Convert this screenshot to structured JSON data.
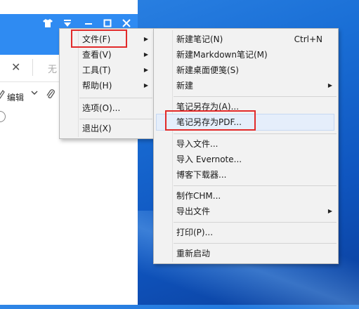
{
  "app": {
    "tab_new_text": "无",
    "toolbar_edit_label": "编辑"
  },
  "main_menu": {
    "items": [
      {
        "label": "文件(F)",
        "has_submenu": true
      },
      {
        "label": "查看(V)",
        "has_submenu": true
      },
      {
        "label": "工具(T)",
        "has_submenu": true
      },
      {
        "label": "帮助(H)",
        "has_submenu": true
      },
      {
        "label": "选项(O)...",
        "has_submenu": false
      },
      {
        "label": "退出(X)",
        "has_submenu": false
      }
    ]
  },
  "file_submenu": {
    "items": [
      {
        "label": "新建笔记(N)",
        "shortcut": "Ctrl+N"
      },
      {
        "label": "新建Markdown笔记(M)"
      },
      {
        "label": "新建桌面便笺(S)"
      },
      {
        "label": "新建",
        "has_submenu": true
      },
      {
        "label": "笔记另存为(A)..."
      },
      {
        "label": "笔记另存为PDF..."
      },
      {
        "label": "导入文件..."
      },
      {
        "label": "导入 Evernote..."
      },
      {
        "label": "博客下载器..."
      },
      {
        "label": "制作CHM..."
      },
      {
        "label": "导出文件",
        "has_submenu": true
      },
      {
        "label": "打印(P)..."
      },
      {
        "label": "重新启动"
      }
    ]
  },
  "colors": {
    "titlebar": "#2f8bf2",
    "menu_bg": "#f2f2f2",
    "highlight": "#e5eefb",
    "annotation_red": "#e22a2a"
  }
}
